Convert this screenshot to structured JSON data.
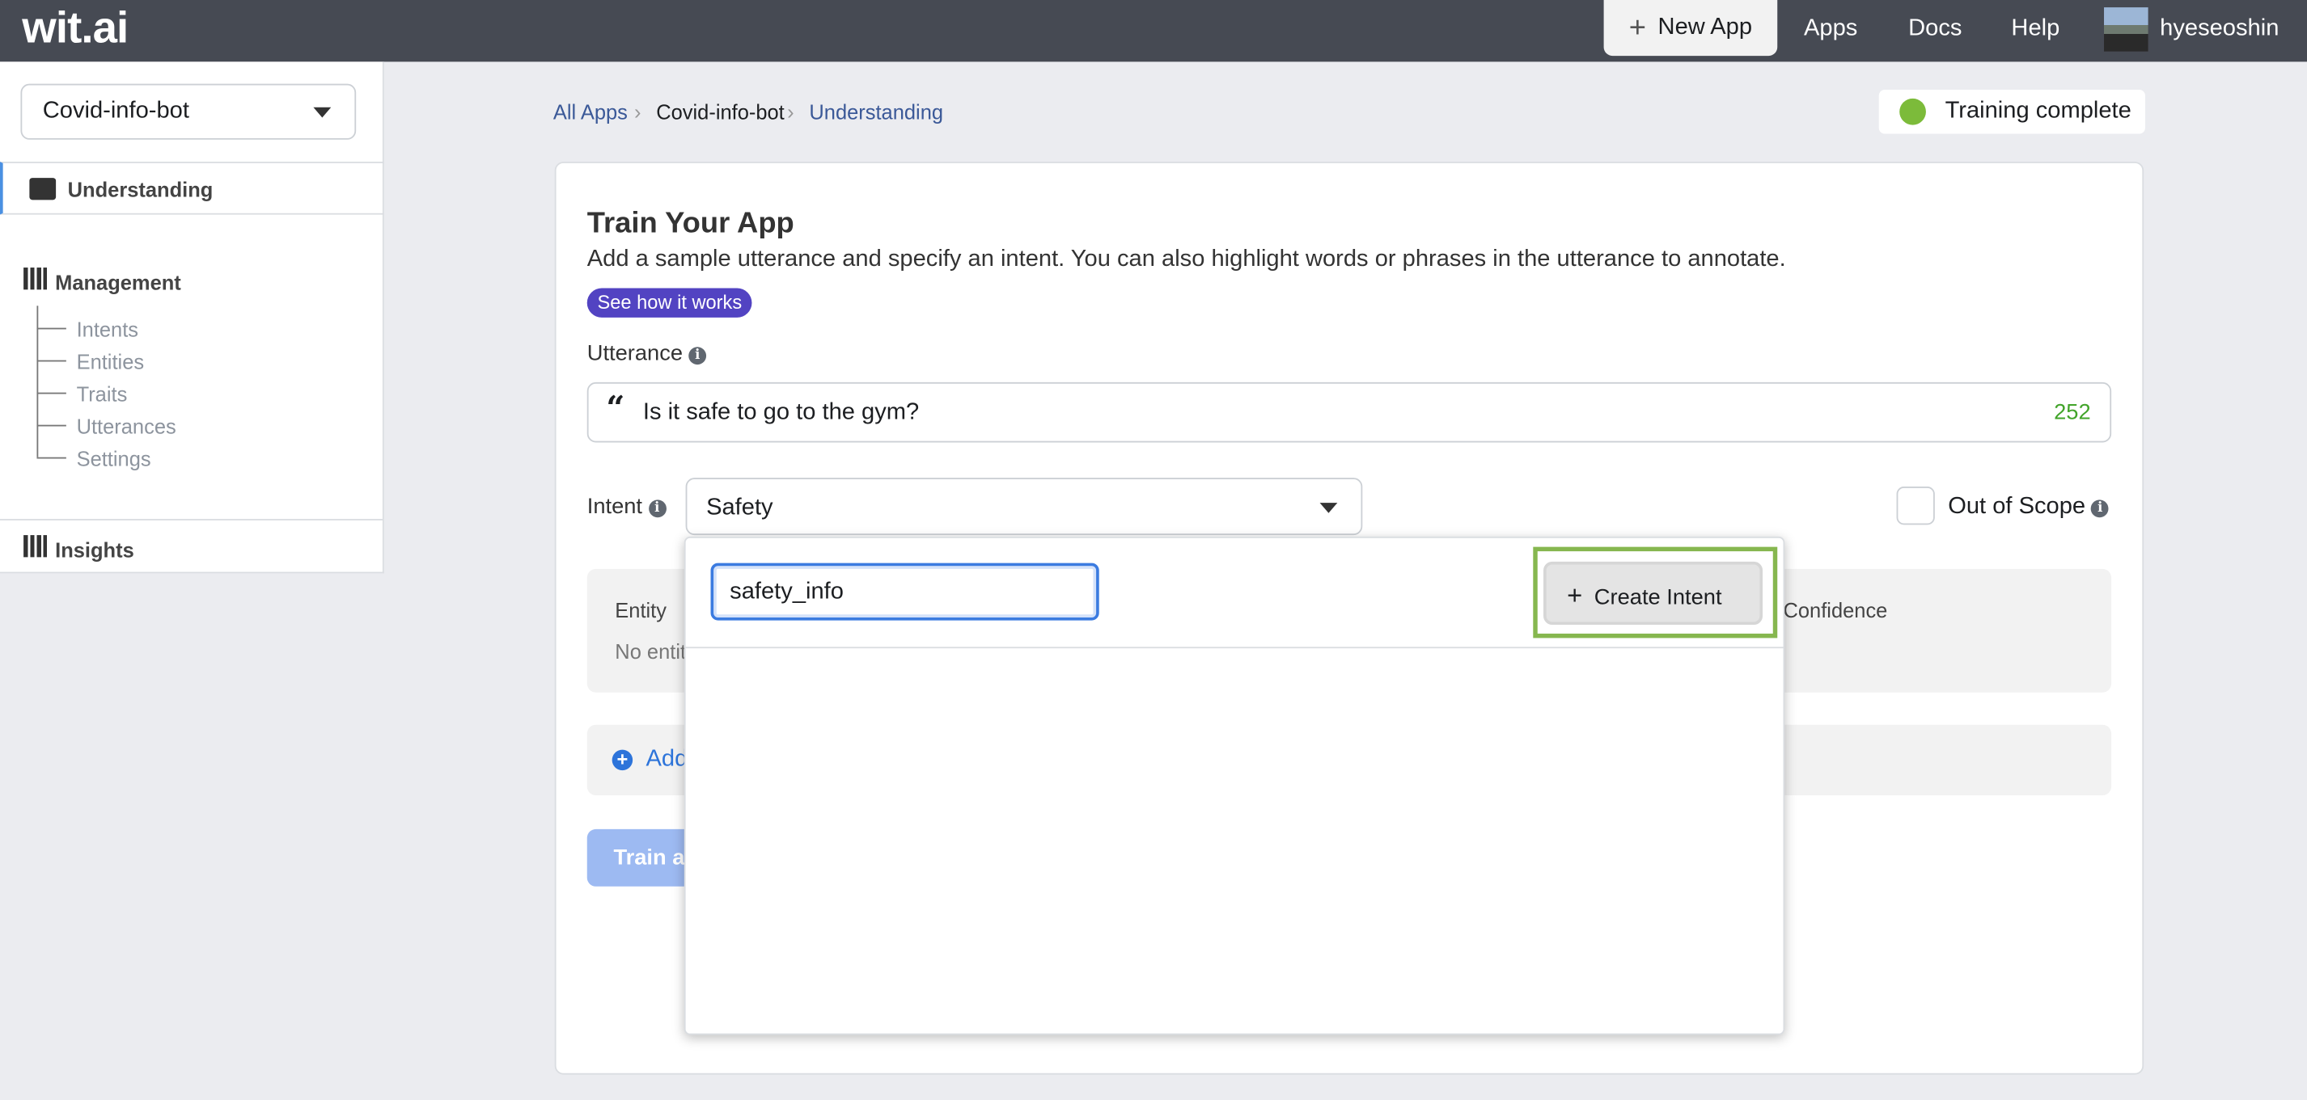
{
  "topbar": {
    "logo": "wit.ai",
    "new_app": "New App",
    "nav": [
      "Apps",
      "Docs",
      "Help"
    ],
    "user": "hyeseoshin"
  },
  "sidebar": {
    "app_selected": "Covid-info-bot",
    "understanding": "Understanding",
    "management": "Management",
    "management_items": [
      "Intents",
      "Entities",
      "Traits",
      "Utterances",
      "Settings"
    ],
    "insights": "Insights"
  },
  "breadcrumb": [
    "All Apps",
    "Covid-info-bot",
    "Understanding"
  ],
  "status": {
    "label": "Training complete",
    "color": "#7cbb3a"
  },
  "card": {
    "title": "Train Your App",
    "description": "Add a sample utterance and specify an intent. You can also highlight words or phrases in the utterance to annotate.",
    "how_link": "See how it works",
    "utterance_label": "Utterance",
    "utterance_value": "Is it safe to go to the gym?",
    "char_remaining": "252",
    "intent_label": "Intent",
    "intent_value": "Safety",
    "out_of_scope": "Out of Scope",
    "entity_header": "Entity",
    "confidence_header": "Confidence",
    "no_entities": "No entities",
    "add_label": "Add",
    "train_button": "Train and Validate"
  },
  "dropdown": {
    "search_value": "safety_info",
    "create_button": "Create Intent"
  },
  "colors": {
    "topbar": "#464a53",
    "pill": "#5243c2",
    "link": "#3b5998",
    "highlight": "#86b74f",
    "train": "#9dbaf2"
  }
}
